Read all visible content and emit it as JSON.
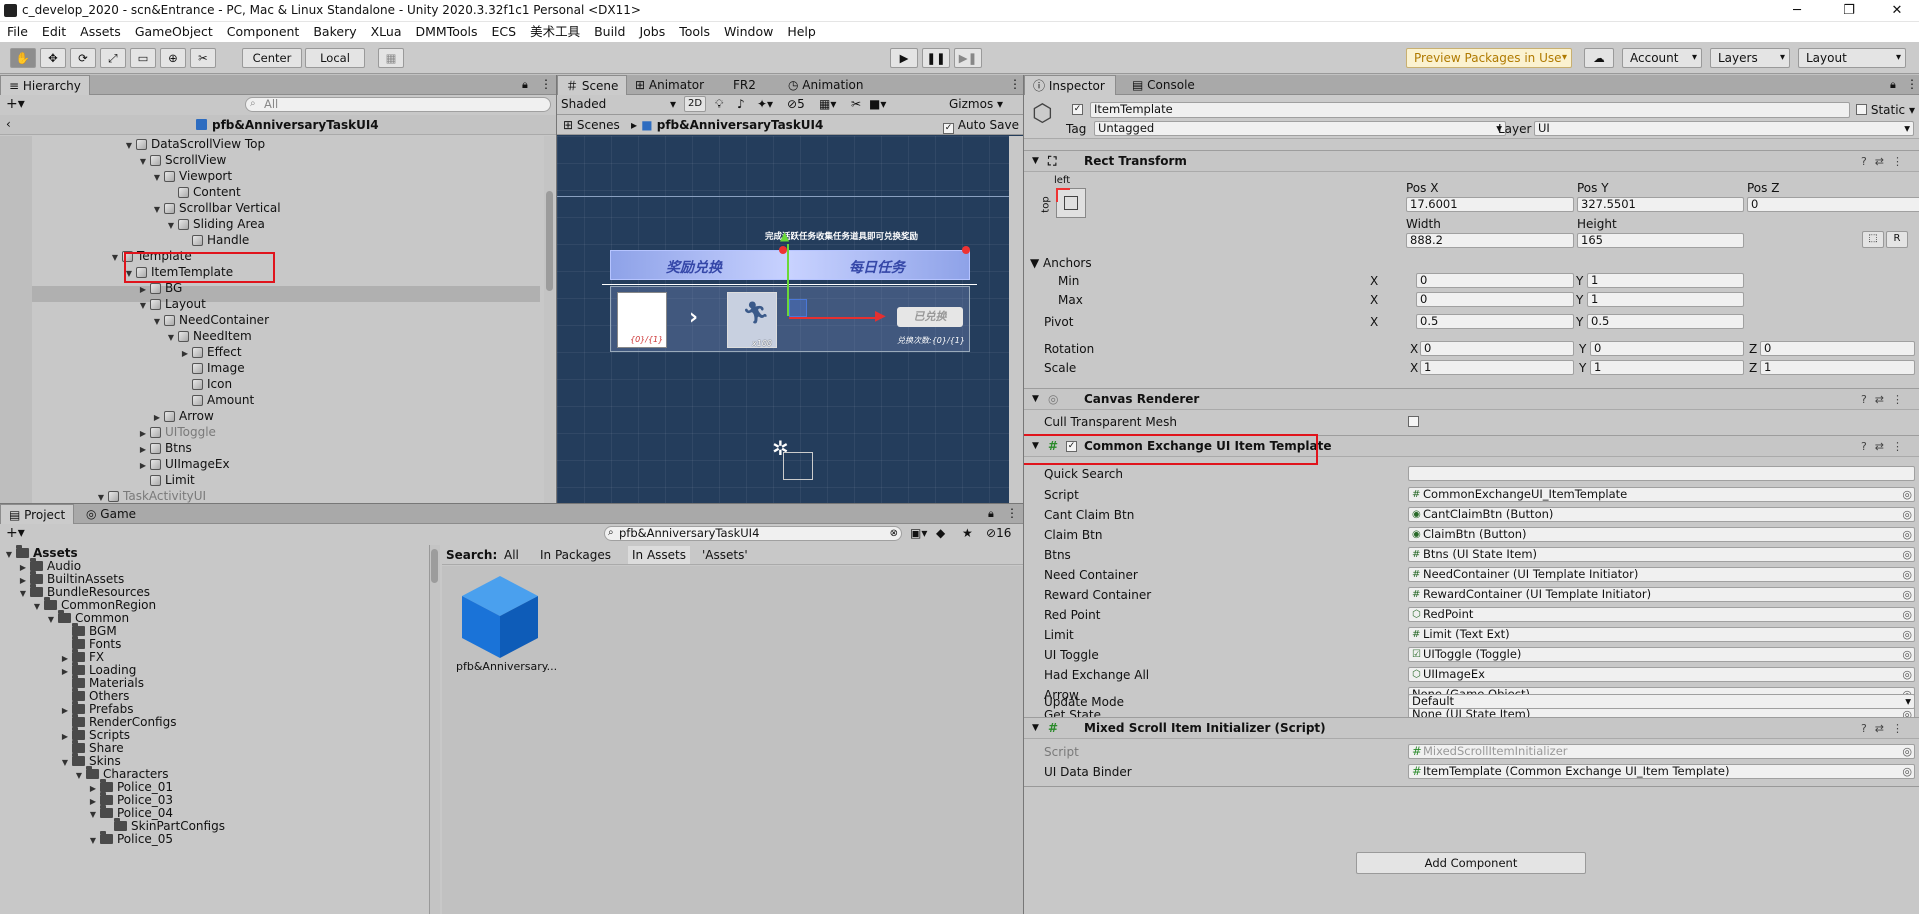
{
  "window": {
    "title": "c_develop_2020 - scn&Entrance - PC, Mac & Linux Standalone - Unity 2020.3.32f1c1 Personal <DX11>"
  },
  "menu": [
    "File",
    "Edit",
    "Assets",
    "GameObject",
    "Component",
    "Bakery",
    "XLua",
    "DMMTools",
    "ECS",
    "美术工具",
    "Build",
    "Jobs",
    "Tools",
    "Window",
    "Help"
  ],
  "toolbar": {
    "center": "Center",
    "local": "Local",
    "preview": "Preview Packages in Use",
    "account": "Account",
    "layers": "Layers",
    "layout": "Layout"
  },
  "hierarchy": {
    "tab": "Hierarchy",
    "search_placeholder": "All",
    "breadcrumb": "pfb&AnniversaryTaskUI4",
    "rows": [
      {
        "label": "DataScrollView Top",
        "indent": 8,
        "arrow": "▼",
        "dim": false
      },
      {
        "label": "ScrollView",
        "indent": 9,
        "arrow": "▼",
        "dim": false
      },
      {
        "label": "Viewport",
        "indent": 10,
        "arrow": "▼",
        "dim": false
      },
      {
        "label": "Content",
        "indent": 11,
        "arrow": "",
        "dim": false
      },
      {
        "label": "Scrollbar Vertical",
        "indent": 10,
        "arrow": "▼",
        "dim": false
      },
      {
        "label": "Sliding Area",
        "indent": 11,
        "arrow": "▼",
        "dim": false
      },
      {
        "label": "Handle",
        "indent": 12,
        "arrow": "",
        "dim": false
      },
      {
        "label": "Template",
        "indent": 7,
        "arrow": "▼",
        "dim": false
      },
      {
        "label": "ItemTemplate",
        "indent": 8,
        "arrow": "▼",
        "dim": false
      },
      {
        "label": "BG",
        "indent": 9,
        "arrow": "▶",
        "dim": false
      },
      {
        "label": "Layout",
        "indent": 9,
        "arrow": "▼",
        "dim": false
      },
      {
        "label": "NeedContainer",
        "indent": 10,
        "arrow": "▼",
        "dim": false
      },
      {
        "label": "NeedItem",
        "indent": 11,
        "arrow": "▼",
        "dim": false
      },
      {
        "label": "Effect",
        "indent": 12,
        "arrow": "▶",
        "dim": false
      },
      {
        "label": "Image",
        "indent": 12,
        "arrow": "",
        "dim": false
      },
      {
        "label": "Icon",
        "indent": 12,
        "arrow": "",
        "dim": false
      },
      {
        "label": "Amount",
        "indent": 12,
        "arrow": "",
        "dim": false
      },
      {
        "label": "Arrow",
        "indent": 10,
        "arrow": "▶",
        "dim": false
      },
      {
        "label": "UIToggle",
        "indent": 9,
        "arrow": "▶",
        "dim": true
      },
      {
        "label": "Btns",
        "indent": 9,
        "arrow": "▶",
        "dim": false
      },
      {
        "label": "UIImageEx",
        "indent": 9,
        "arrow": "▶",
        "dim": false
      },
      {
        "label": "Limit",
        "indent": 9,
        "arrow": "",
        "dim": false
      },
      {
        "label": "TaskActivityUI",
        "indent": 6,
        "arrow": "▼",
        "dim": true
      }
    ]
  },
  "scene": {
    "tabs": [
      "Scene",
      "Animator",
      "FR2",
      "Animation"
    ],
    "shading": "Shaded",
    "mode_2d": "2D",
    "hidden_count": "5",
    "gizmos": "Gizmos",
    "breadcrumb_root": "Scenes",
    "breadcrumb_prefab": "pfb&AnniversaryTaskUI4",
    "auto_save": "Auto Save",
    "game": {
      "banner_title": "完成活跃任务收集任务道具即可兑换奖励",
      "tab_left": "奖励兑换",
      "tab_right": "每日任务",
      "need_amount": "{0}/{1}",
      "reward_amount": "x100",
      "btn_claimed": "已兑换",
      "limit_text": "兑换次数:{0}/{1}"
    }
  },
  "project": {
    "tabs": [
      "Project",
      "Game"
    ],
    "search_value": "pfb&AnniversaryTaskUI4",
    "hidden_count": "16",
    "search_label": "Search:",
    "filters": [
      "All",
      "In Packages",
      "In Assets",
      "'Assets'"
    ],
    "asset_name": "pfb&Anniversary...",
    "tree": [
      {
        "label": "Assets",
        "indent": 0,
        "arrow": "▼",
        "bold": true
      },
      {
        "label": "Audio",
        "indent": 1,
        "arrow": "▶"
      },
      {
        "label": "BuiltinAssets",
        "indent": 1,
        "arrow": "▶"
      },
      {
        "label": "BundleResources",
        "indent": 1,
        "arrow": "▼"
      },
      {
        "label": "CommonRegion",
        "indent": 2,
        "arrow": "▼"
      },
      {
        "label": "Common",
        "indent": 3,
        "arrow": "▼"
      },
      {
        "label": "BGM",
        "indent": 4,
        "arrow": ""
      },
      {
        "label": "Fonts",
        "indent": 4,
        "arrow": ""
      },
      {
        "label": "FX",
        "indent": 4,
        "arrow": "▶"
      },
      {
        "label": "Loading",
        "indent": 4,
        "arrow": "▶"
      },
      {
        "label": "Materials",
        "indent": 4,
        "arrow": ""
      },
      {
        "label": "Others",
        "indent": 4,
        "arrow": ""
      },
      {
        "label": "Prefabs",
        "indent": 4,
        "arrow": "▶"
      },
      {
        "label": "RenderConfigs",
        "indent": 4,
        "arrow": ""
      },
      {
        "label": "Scripts",
        "indent": 4,
        "arrow": "▶"
      },
      {
        "label": "Share",
        "indent": 4,
        "arrow": ""
      },
      {
        "label": "Skins",
        "indent": 4,
        "arrow": "▼"
      },
      {
        "label": "Characters",
        "indent": 5,
        "arrow": "▼"
      },
      {
        "label": "Police_01",
        "indent": 6,
        "arrow": "▶"
      },
      {
        "label": "Police_03",
        "indent": 6,
        "arrow": "▶"
      },
      {
        "label": "Police_04",
        "indent": 6,
        "arrow": "▼"
      },
      {
        "label": "SkinPartConfigs",
        "indent": 7,
        "arrow": ""
      },
      {
        "label": "Police_05",
        "indent": 6,
        "arrow": "▼"
      }
    ]
  },
  "inspector": {
    "tabs": [
      "Inspector",
      "Console"
    ],
    "object_name": "ItemTemplate",
    "static": "Static",
    "tag_label": "Tag",
    "tag_value": "Untagged",
    "layer_label": "Layer",
    "layer_value": "UI",
    "rect": {
      "header": "Rect Transform",
      "anchor_h": "left",
      "anchor_v": "top",
      "posx_label": "Pos X",
      "posy_label": "Pos Y",
      "posz_label": "Pos Z",
      "posx": "17.6001",
      "posy": "327.5501",
      "posz": "0",
      "width_label": "Width",
      "height_label": "Height",
      "width": "888.2",
      "height": "165",
      "r_btn": "R",
      "anchors": "Anchors",
      "min": "Min",
      "max": "Max",
      "min_x": "0",
      "min_y": "1",
      "max_x": "0",
      "max_y": "1",
      "pivot": "Pivot",
      "pivot_x": "0.5",
      "pivot_y": "0.5",
      "rotation": "Rotation",
      "rot_x": "0",
      "rot_y": "0",
      "rot_z": "0",
      "scale": "Scale",
      "scale_x": "1",
      "scale_y": "1",
      "scale_z": "1",
      "x": "X",
      "y": "Y",
      "z": "Z"
    },
    "canvas_renderer": {
      "header": "Canvas Renderer",
      "cull_label": "Cull Transparent Mesh"
    },
    "cex": {
      "header": "Common Exchange UI Item Template",
      "quick_search": "Quick Search",
      "fields": [
        {
          "label": "Script",
          "value": "CommonExchangeUI_ItemTemplate",
          "icon": "#"
        },
        {
          "label": "Cant Claim Btn",
          "value": "CantClaimBtn (Button)",
          "icon": "◉"
        },
        {
          "label": "Claim Btn",
          "value": "ClaimBtn (Button)",
          "icon": "◉"
        },
        {
          "label": "Btns",
          "value": "Btns (UI State Item)",
          "icon": "#"
        },
        {
          "label": "Need Container",
          "value": "NeedContainer (UI Template Initiator)",
          "icon": "#"
        },
        {
          "label": "Reward Container",
          "value": "RewardContainer (UI Template Initiator)",
          "icon": "#"
        },
        {
          "label": "Red Point",
          "value": "RedPoint",
          "icon": "⬡"
        },
        {
          "label": "Limit",
          "value": "Limit (Text Ext)",
          "icon": "#"
        },
        {
          "label": "UI Toggle",
          "value": "UIToggle (Toggle)",
          "icon": "☑"
        },
        {
          "label": "Had Exchange All",
          "value": "UIImageEx",
          "icon": "⬡"
        },
        {
          "label": "Arrow",
          "value": "None (Game Object)",
          "icon": ""
        },
        {
          "label": "Get State",
          "value": "None (UI State Item)",
          "icon": ""
        }
      ],
      "update_mode_label": "Update Mode",
      "update_mode": "Default"
    },
    "mixed": {
      "header": "Mixed Scroll Item Initializer (Script)",
      "script_label": "Script",
      "script_value": "MixedScrollItemInitializer",
      "binder_label": "UI Data Binder",
      "binder_value": "ItemTemplate (Common Exchange UI_Item Template)"
    },
    "add_component": "Add Component"
  },
  "colors": {
    "accent_red": "#e0141c",
    "scene_bg": "#243d5c",
    "selection": "#b0b0b0"
  }
}
